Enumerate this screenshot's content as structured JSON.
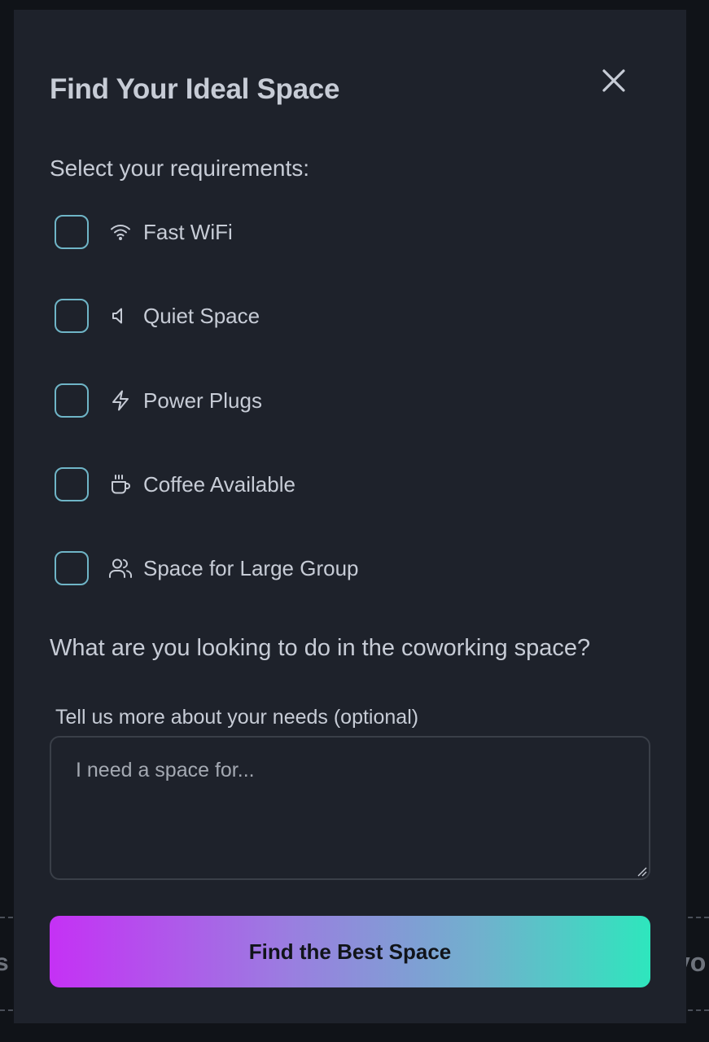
{
  "modal": {
    "title": "Find Your Ideal Space",
    "close_icon": "close-icon"
  },
  "requirements": {
    "label": "Select your requirements:",
    "items": [
      {
        "label": "Fast WiFi",
        "icon": "wifi-icon",
        "checked": false
      },
      {
        "label": "Quiet Space",
        "icon": "speaker-icon",
        "checked": false
      },
      {
        "label": "Power Plugs",
        "icon": "lightning-icon",
        "checked": false
      },
      {
        "label": "Coffee Available",
        "icon": "coffee-icon",
        "checked": false
      },
      {
        "label": "Space for Large Group",
        "icon": "users-icon",
        "checked": false
      }
    ]
  },
  "activity": {
    "question": "What are you looking to do in the coworking space?",
    "field_label": "Tell us more about your needs (optional)",
    "placeholder": "I need a space for...",
    "value": ""
  },
  "submit": {
    "label": "Find the Best Space"
  },
  "background": {
    "left_fragment": "s",
    "right_fragment": "yo"
  },
  "colors": {
    "modal_bg": "#1e222b",
    "checkbox_border": "#6fb5c7",
    "text": "#c7ccd6",
    "gradient_start": "#c531f5",
    "gradient_end": "#2ee6bd"
  }
}
